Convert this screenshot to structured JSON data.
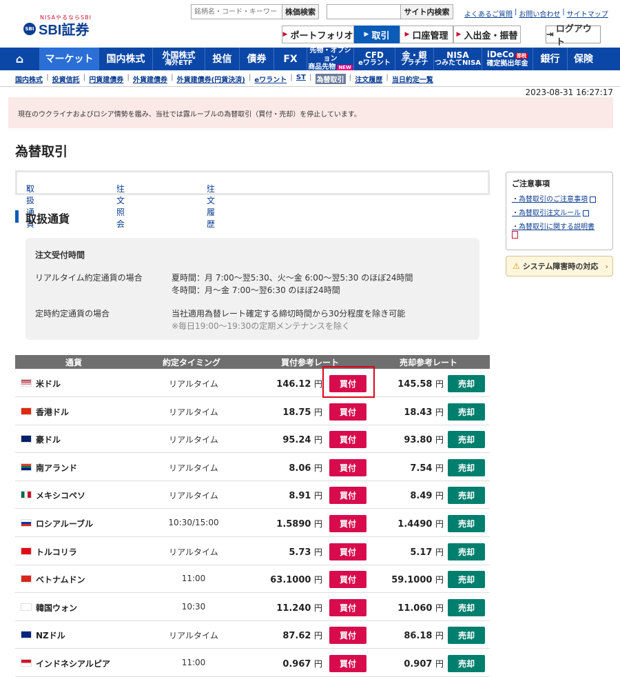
{
  "header": {
    "logo_sub": "NISAやるならSBI",
    "logo_mark": "SBI",
    "logo_text": "SBI証券",
    "stock_search_placeholder": "銘柄名・コード・キーワード",
    "stock_search_btn": "株価検索",
    "site_search_btn": "サイト内検索",
    "links": [
      "よくあるご質問",
      "お問い合わせ",
      "サイトマップ"
    ],
    "top_buttons": [
      "ポートフォリオ",
      "取引",
      "口座管理",
      "入出金・振替"
    ],
    "logout": "ログアウト"
  },
  "nav": {
    "home_icon": "home-icon",
    "items": [
      {
        "l1": "マーケット",
        "l2": ""
      },
      {
        "l1": "国内株式",
        "l2": ""
      },
      {
        "l1": "外国株式",
        "l2": "海外ETF"
      },
      {
        "l1": "投信",
        "l2": ""
      },
      {
        "l1": "債券",
        "l2": ""
      },
      {
        "l1": "FX",
        "l2": ""
      },
      {
        "l1": "先物・オプション",
        "l2": "商品先物"
      },
      {
        "l1": "CFD",
        "l2": "eワラント"
      },
      {
        "l1": "金・銀",
        "l2": "プラチナ"
      },
      {
        "l1": "NISA",
        "l2": "つみたてNISA"
      },
      {
        "l1": "iDeCo",
        "l2": "確定拠出年金"
      },
      {
        "l1": "銀行",
        "l2": ""
      },
      {
        "l1": "保険",
        "l2": ""
      }
    ],
    "new_badge": "NEW",
    "ideco_badge": "節税"
  },
  "subnav": [
    "国内株式",
    "投資信託",
    "円貨建債券",
    "外貨建債券",
    "外貨建債券(円貨決済)",
    "eワラント",
    "ST",
    "為替取引",
    "注文履歴",
    "当日約定一覧"
  ],
  "timestamp": "2023-08-31 16:27:17",
  "notice": "現在のウクライナおよびロシア情勢を鑑み、当社では露ルーブルの為替取引（買付・売却）を停止しています。",
  "page_title": "為替取引",
  "tabs": [
    "取扱通貨",
    "注文照会",
    "注文履歴"
  ],
  "section_title": "取扱通貨",
  "hours": {
    "title": "注文受付時間",
    "realtime_label": "リアルタイム約定通貨の場合",
    "realtime_line1": "夏時間：月 7:00～翌5:30、火～金 6:00～翌5:30 のほぼ24時間",
    "realtime_line2": "冬時間：月～金 7:00～翌6:30 のほぼ24時間",
    "fixed_label": "定時約定通貨の場合",
    "fixed_line1": "当社適用為替レート確定する締切時間から30分程度を除き可能",
    "fixed_note": "※毎日19:00～19:30の定期メンテナンスを除く"
  },
  "side": {
    "title": "ご注意事項",
    "links": [
      "為替取引のご注意事項",
      "為替取引注文ルール",
      "為替取引に関する説明書"
    ],
    "system_btn": "システム障害時の対応"
  },
  "table": {
    "headers": [
      "通貨",
      "約定タイミング",
      "買付参考レート",
      "売却参考レート"
    ],
    "buy_label": "買付",
    "sell_label": "売却",
    "yen": "円",
    "rows": [
      {
        "name": "米ドル",
        "timing": "リアルタイム",
        "buy": "146.12",
        "sell": "145.58"
      },
      {
        "name": "香港ドル",
        "timing": "リアルタイム",
        "buy": "18.75",
        "sell": "18.43"
      },
      {
        "name": "豪ドル",
        "timing": "リアルタイム",
        "buy": "95.24",
        "sell": "93.80"
      },
      {
        "name": "南アランド",
        "timing": "リアルタイム",
        "buy": "8.06",
        "sell": "7.54"
      },
      {
        "name": "メキシコペソ",
        "timing": "リアルタイム",
        "buy": "8.91",
        "sell": "8.49"
      },
      {
        "name": "ロシアルーブル",
        "timing": "10:30/15:00",
        "buy": "1.5890",
        "sell": "1.4490"
      },
      {
        "name": "トルコリラ",
        "timing": "リアルタイム",
        "buy": "5.73",
        "sell": "5.17"
      },
      {
        "name": "ベトナムドン",
        "timing": "11:00",
        "buy": "63.1000",
        "sell": "59.1000"
      },
      {
        "name": "韓国ウォン",
        "timing": "10:30",
        "buy": "11.240",
        "sell": "11.060"
      },
      {
        "name": "NZドル",
        "timing": "リアルタイム",
        "buy": "87.62",
        "sell": "86.18"
      },
      {
        "name": "インドネシアルピア",
        "timing": "11:00",
        "buy": "0.967",
        "sell": "0.907"
      }
    ]
  },
  "colors": {
    "buy": "#d80c4d",
    "sell": "#007f6e",
    "nav": "#0b47a6"
  }
}
